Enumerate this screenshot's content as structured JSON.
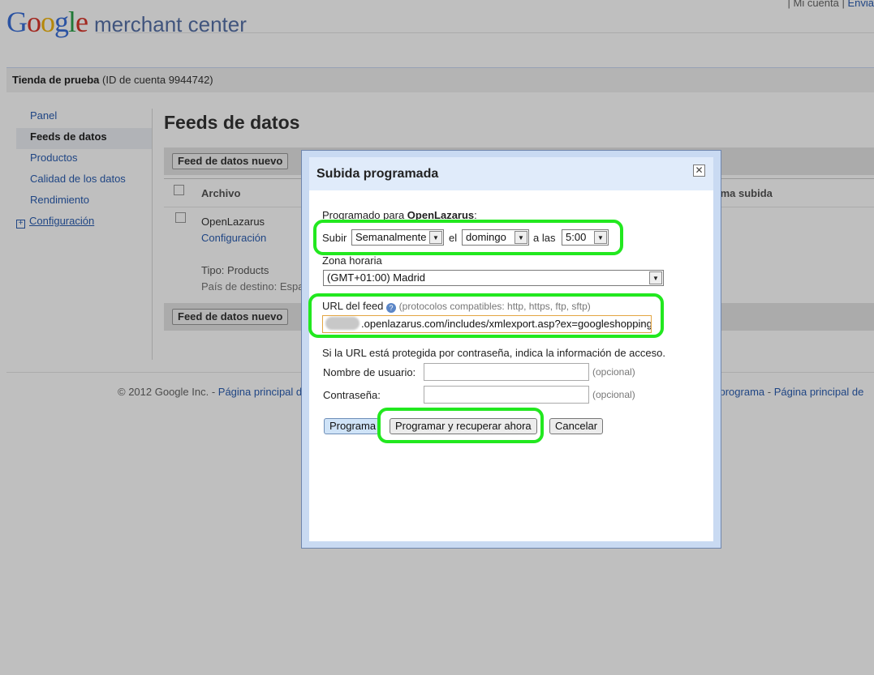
{
  "header": {
    "logo_google": "Google",
    "logo_product": "merchant center",
    "links": [
      "| Mi cuenta |",
      "Envia"
    ]
  },
  "account": {
    "store_name": "Tienda de prueba",
    "account_id_text": "(ID de cuenta 9944742)"
  },
  "sidebar": {
    "items": [
      {
        "label": "Panel"
      },
      {
        "label": "Feeds de datos"
      },
      {
        "label": "Productos"
      },
      {
        "label": "Calidad de los datos"
      },
      {
        "label": "Rendimiento"
      },
      {
        "label": "Configuración"
      }
    ]
  },
  "main": {
    "title": "Feeds de datos",
    "new_feed_button": "Feed de datos nuevo",
    "columns": {
      "archivo": "Archivo",
      "ultima_subida": "ima subida"
    },
    "row": {
      "name": "OpenLazarus",
      "config_link": "Configuración",
      "tipo": "Tipo: Products",
      "pais": "País de destino: Espa"
    }
  },
  "footer": {
    "copyright": "© 2012 Google Inc. -",
    "link_left": "Página principal d",
    "link_right_1": "l programa",
    "separator": "-",
    "link_right_2": "Página principal de"
  },
  "dialog": {
    "title": "Subida programada",
    "close_glyph": "✕",
    "scheduled_for_prefix": "Programado para",
    "scheduled_for_name": "OpenLazarus",
    "scheduled_for_suffix": ":",
    "upload_label": "Subir",
    "frequency_value": "Semanalmente",
    "el_label": "el",
    "day_value": "domingo",
    "at_label": "a las",
    "time_value": "5:00",
    "timezone_label": "Zona horaria",
    "timezone_value": "(GMT+01:00) Madrid",
    "feed_url_label": "URL del feed",
    "help_glyph": "?",
    "feed_url_protocols": "(protocolos compatibles: http, https, ftp, sftp)",
    "feed_url_value": ".openlazarus.com/includes/xmlexport.asp?ex=googleshopping",
    "password_hint": "Si la URL está protegida por contraseña, indica la información de acceso.",
    "username_label": "Nombre de usuario:",
    "password_label": "Contraseña:",
    "optional_text": "(opcional)",
    "buttons": {
      "schedule": "Programa",
      "schedule_fetch": "Programar y recuperar ahora",
      "cancel": "Cancelar"
    }
  },
  "highlight_color": "#22e81f"
}
